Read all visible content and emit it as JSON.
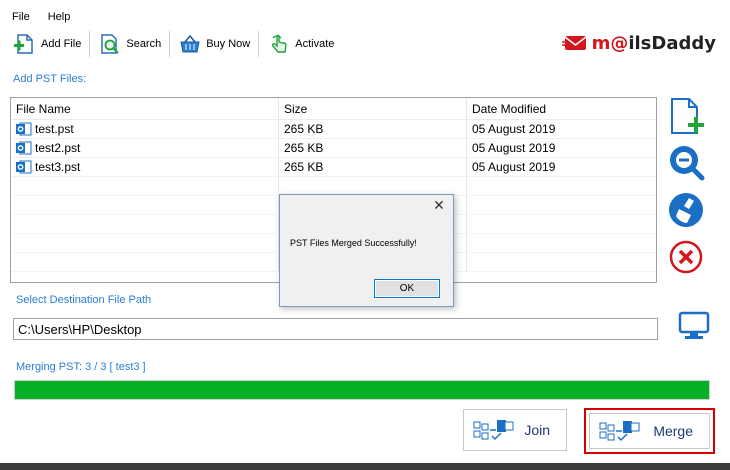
{
  "menu": {
    "file": "File",
    "help": "Help"
  },
  "toolbar": {
    "add_file": "Add File",
    "search": "Search",
    "buy_now": "Buy Now",
    "activate": "Activate"
  },
  "logo": {
    "prefix": "m",
    "at": "@",
    "suffix": "ilsDaddy"
  },
  "add_pst_label": "Add PST Files:",
  "grid": {
    "headers": [
      "File Name",
      "Size",
      "Date Modified"
    ],
    "rows": [
      {
        "name": "test.pst",
        "size": "265 KB",
        "date": "05 August 2019"
      },
      {
        "name": "test2.pst",
        "size": "265 KB",
        "date": "05 August 2019"
      },
      {
        "name": "test3.pst",
        "size": "265 KB",
        "date": "05 August 2019"
      }
    ]
  },
  "destination_label": "Select Destination File Path",
  "destination_path": "C:\\Users\\HP\\Desktop",
  "merging_status": "Merging PST: 3 / 3 [ test3 ]",
  "progress": {
    "fraction": 1.0,
    "color": "#06b025"
  },
  "buttons": {
    "join": "Join",
    "merge": "Merge"
  },
  "dialog": {
    "message": "PST Files Merged Successfully!",
    "ok": "OK"
  },
  "colors": {
    "accent_label": "#2a7fd4",
    "highlight": "#d40000",
    "brand": "#d4151c"
  },
  "icons": {
    "add_file": "add-file-icon",
    "search": "search-icon",
    "buy_now": "basket-icon",
    "activate": "activate-hand-icon",
    "pst_file": "outlook-file-icon",
    "side_add": "add-document-icon",
    "side_search": "magnifier-icon",
    "side_clear": "brush-icon",
    "side_remove": "remove-icon",
    "browse": "monitor-icon"
  }
}
